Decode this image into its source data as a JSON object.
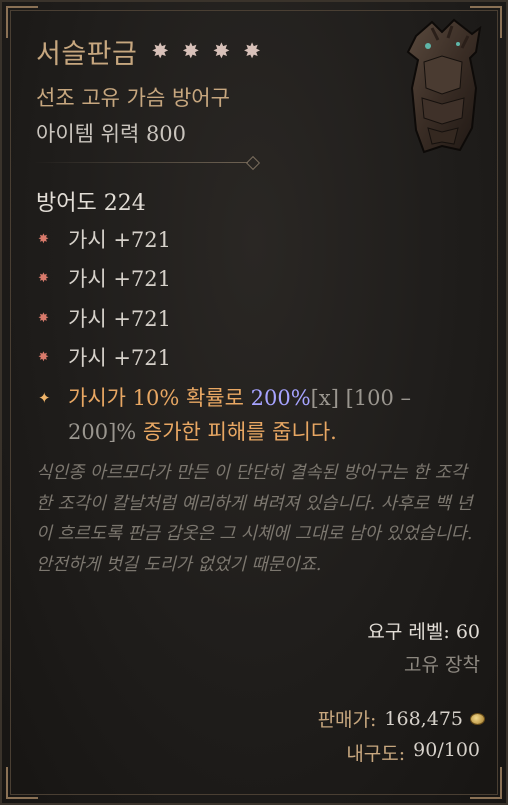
{
  "item": {
    "name": "서슬판금",
    "type": "선조 고유 가슴 방어구",
    "power": "아이템 위력 800",
    "armor": "방어도 224",
    "stars": [
      "✸",
      "✸",
      "✸",
      "✸"
    ]
  },
  "affixes": [
    {
      "text": "가시 +721"
    },
    {
      "text": "가시 +721"
    },
    {
      "text": "가시 +721"
    },
    {
      "text": "가시 +721"
    }
  ],
  "legendary": {
    "part1": "가시가 10% 확률로 ",
    "highlight": "200%",
    "bracket_x": "[x]",
    "range_a": " [100 –",
    "range_b": "200]%",
    "part2": " 증가한 피해를 줍니다."
  },
  "flavor": "식인종 아르모다가 만든 이 단단히 결속된 방어구는 한 조각 한 조각이 칼날처럼 예리하게 벼려져 있습니다. 사후로 백 년이 흐르도록 판금 갑옷은 그 시체에 그대로 남아 있었습니다. 안전하게 벗길 도리가 없었기 때문이죠.",
  "requirements": {
    "level": "요구 레벨: 60",
    "unique": "고유 장착"
  },
  "footer": {
    "sell_label": "판매가:",
    "sell_value": "168,475",
    "durability_label": "내구도:",
    "durability_value": "90/100"
  },
  "colors": {
    "unique_gold": "#c7a77f",
    "affix_bullet": "#d97a6b",
    "legendary_orange": "#e8a763",
    "legendary_value": "#a6a3ff"
  }
}
